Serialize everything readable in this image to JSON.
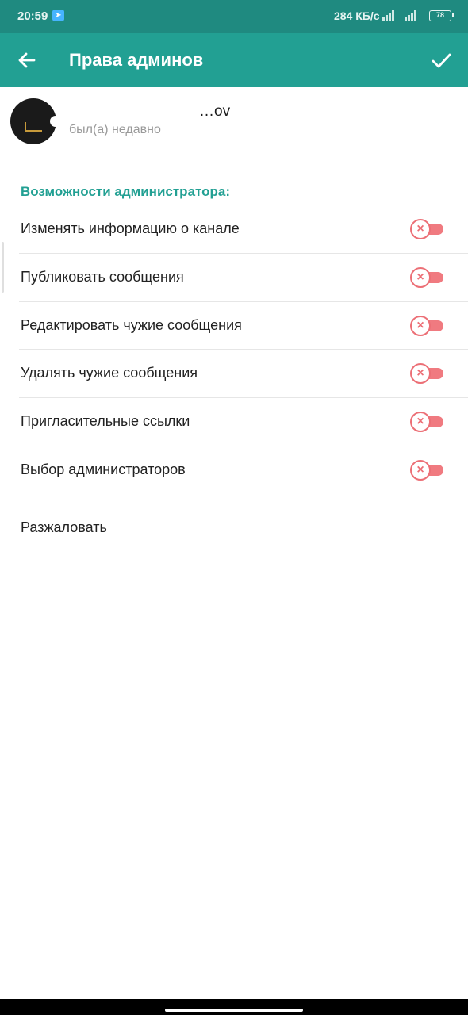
{
  "status_bar": {
    "time": "20:59",
    "app_icon": "telegram-notification-icon",
    "network_speed": "284 КБ/с",
    "signal_label": "4G",
    "battery": "78"
  },
  "app_bar": {
    "title": "Права админов",
    "back_icon": "arrow-left-icon",
    "done_icon": "check-icon"
  },
  "user": {
    "name": "…ov",
    "status": "был(а) недавно"
  },
  "section": {
    "title": "Возможности администратора:"
  },
  "permissions": [
    {
      "label": "Изменять информацию о канале",
      "enabled": false
    },
    {
      "label": "Публиковать сообщения",
      "enabled": false
    },
    {
      "label": "Редактировать чужие сообщения",
      "enabled": false
    },
    {
      "label": "Удалять чужие сообщения",
      "enabled": false
    },
    {
      "label": "Пригласительные ссылки",
      "enabled": false
    },
    {
      "label": "Выбор администраторов",
      "enabled": false
    }
  ],
  "actions": {
    "demote_label": "Разжаловать"
  },
  "colors": {
    "header": "#22a093",
    "status_bar": "#1f8a80",
    "accent": "#22a093",
    "toggle_off": "#f07a80"
  }
}
